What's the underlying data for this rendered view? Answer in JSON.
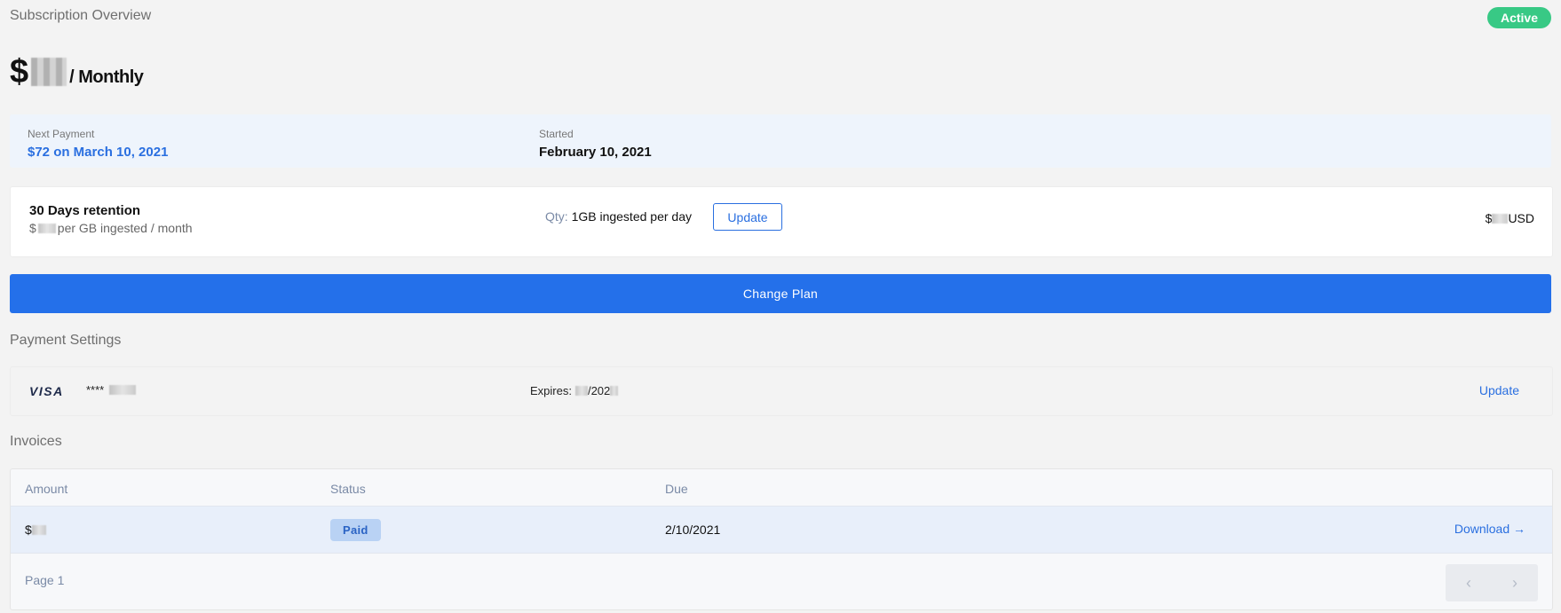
{
  "header": {
    "title": "Subscription Overview",
    "status": "Active",
    "price_prefix": "$",
    "price_period": "/ Monthly"
  },
  "payment_info": {
    "next_payment_label": "Next Payment",
    "next_payment_value": "$72 on March 10, 2021",
    "started_label": "Started",
    "started_value": "February 10, 2021"
  },
  "plan": {
    "name": "30 Days retention",
    "rate_prefix": "$",
    "rate_suffix": "per GB ingested / month",
    "qty_label": "Qty:",
    "qty_value": "1GB ingested per day",
    "update_label": "Update",
    "total_prefix": "$",
    "total_suffix": "USD"
  },
  "change_plan_label": "Change Plan",
  "payment_settings": {
    "title": "Payment Settings",
    "card_brand": "VISA",
    "card_mask": "****",
    "expires_label": "Expires:",
    "expires_year": "/202",
    "update_label": "Update"
  },
  "invoices": {
    "title": "Invoices",
    "columns": [
      "Amount",
      "Status",
      "Due"
    ],
    "rows": [
      {
        "amount_prefix": "$",
        "status": "Paid",
        "due": "2/10/2021",
        "action": "Download"
      }
    ],
    "page_label": "Page 1"
  },
  "colors": {
    "accent": "#2470ea",
    "active_badge": "#38c985",
    "paid_badge_bg": "#b9d2f4"
  }
}
